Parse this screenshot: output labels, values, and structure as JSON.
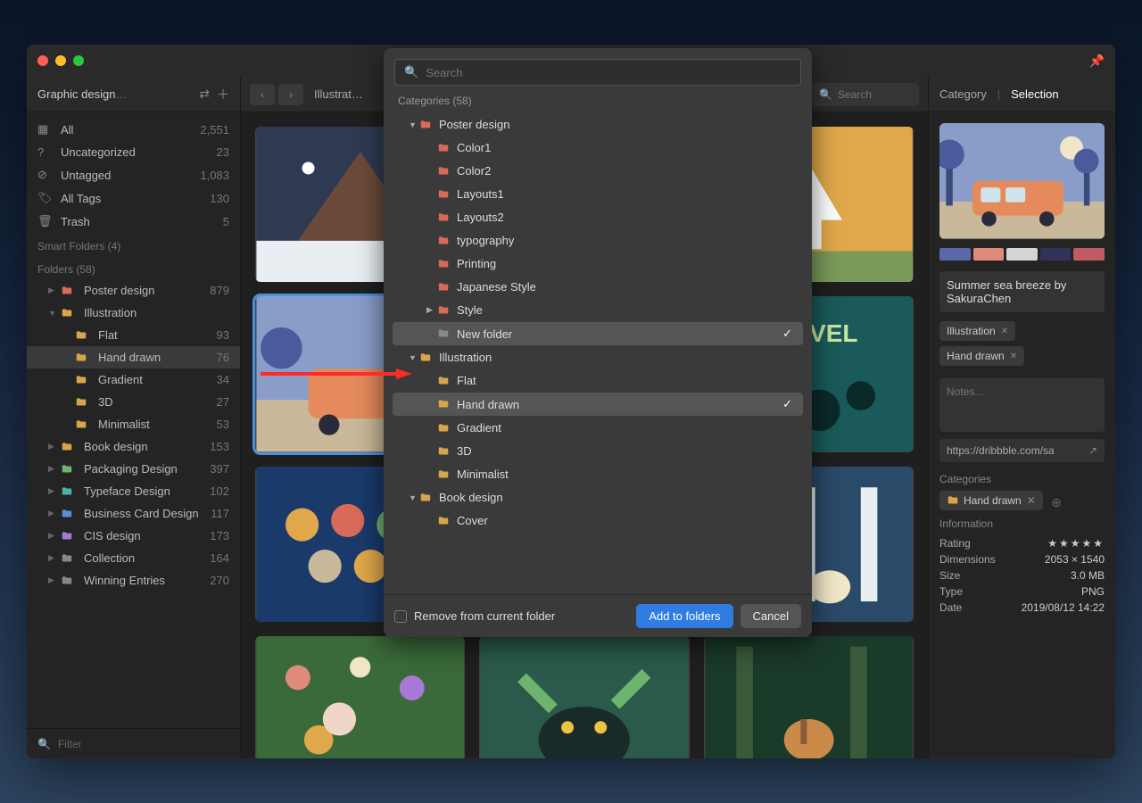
{
  "window": {
    "library_name": "Graphic design",
    "breadcrumb": "Illustrat…",
    "search_placeholder": "Search",
    "pin_glyph": "📌"
  },
  "tabs": {
    "category": "Category",
    "selection": "Selection"
  },
  "sidebar": {
    "system": [
      {
        "icon": "grid",
        "label": "All",
        "count": "2,551"
      },
      {
        "icon": "help",
        "label": "Uncategorized",
        "count": "23"
      },
      {
        "icon": "tagx",
        "label": "Untagged",
        "count": "1,083"
      },
      {
        "icon": "tags",
        "label": "All Tags",
        "count": "130"
      },
      {
        "icon": "trash",
        "label": "Trash",
        "count": "5"
      }
    ],
    "smart_header": "Smart Folders (4)",
    "folders_header": "Folders (58)",
    "folders": [
      {
        "label": "Poster design",
        "count": "879",
        "color": "red",
        "expanded": false
      },
      {
        "label": "Illustration",
        "count": "",
        "color": "orange",
        "expanded": true,
        "children": [
          {
            "label": "Flat",
            "count": "93"
          },
          {
            "label": "Hand drawn",
            "count": "76",
            "selected": true
          },
          {
            "label": "Gradient",
            "count": "34"
          },
          {
            "label": "3D",
            "count": "27"
          },
          {
            "label": "Minimalist",
            "count": "53"
          }
        ]
      },
      {
        "label": "Book design",
        "count": "153",
        "color": "orange"
      },
      {
        "label": "Packaging Design",
        "count": "397",
        "color": "green"
      },
      {
        "label": "Typeface Design",
        "count": "102",
        "color": "teal"
      },
      {
        "label": "Business Card Design",
        "count": "117",
        "color": "blue"
      },
      {
        "label": "CIS design",
        "count": "173",
        "color": "purple"
      },
      {
        "label": "Collection",
        "count": "164",
        "color": "gray"
      },
      {
        "label": "Winning Entries",
        "count": "270",
        "color": "gray"
      }
    ],
    "filter_placeholder": "Filter"
  },
  "modal": {
    "search_placeholder": "Search",
    "subhead": "Categories (58)",
    "tree": [
      {
        "label": "Poster design",
        "color": "red",
        "depth": 1,
        "expanded": true
      },
      {
        "label": "Color1",
        "color": "red",
        "depth": 2
      },
      {
        "label": "Color2",
        "color": "red",
        "depth": 2
      },
      {
        "label": "Layouts1",
        "color": "red",
        "depth": 2
      },
      {
        "label": "Layouts2",
        "color": "red",
        "depth": 2
      },
      {
        "label": "typography",
        "color": "red",
        "depth": 2
      },
      {
        "label": "Printing",
        "color": "red",
        "depth": 2
      },
      {
        "label": "Japanese Style",
        "color": "red",
        "depth": 2
      },
      {
        "label": "Style",
        "color": "red",
        "depth": 2,
        "hasChildren": true
      },
      {
        "label": "New folder",
        "color": "gray",
        "depth": 2,
        "selected": true,
        "checked": true
      },
      {
        "label": "Illustration",
        "color": "orange",
        "depth": 1,
        "expanded": true
      },
      {
        "label": "Flat",
        "color": "orange",
        "depth": 2
      },
      {
        "label": "Hand drawn",
        "color": "orange",
        "depth": 2,
        "selected": true,
        "checked": true
      },
      {
        "label": "Gradient",
        "color": "orange",
        "depth": 2
      },
      {
        "label": "3D",
        "color": "orange",
        "depth": 2
      },
      {
        "label": "Minimalist",
        "color": "orange",
        "depth": 2
      },
      {
        "label": "Book design",
        "color": "orange",
        "depth": 1,
        "expanded": true
      },
      {
        "label": "Cover",
        "color": "orange",
        "depth": 2
      }
    ],
    "remove_label": "Remove from current folder",
    "add_label": "Add to folders",
    "cancel_label": "Cancel"
  },
  "inspector": {
    "swatches": [
      "#5a67a8",
      "#e08a7b",
      "#d5d5d5",
      "#32315a",
      "#c15a63"
    ],
    "title": "Summer sea breeze by SakuraChen",
    "tags": [
      "Illustration",
      "Hand drawn"
    ],
    "notes_placeholder": "Notes...",
    "url": "https://dribbble.com/sa",
    "categories_label": "Categories",
    "category_chip": "Hand drawn",
    "info_label": "Information",
    "rating_label": "Rating",
    "rating_value": "★★★★★",
    "dimensions_label": "Dimensions",
    "dimensions_value": "2053 × 1540",
    "size_label": "Size",
    "size_value": "3.0 MB",
    "type_label": "Type",
    "type_value": "PNG",
    "date_label": "Date",
    "date_value": "2019/08/12 14:22"
  }
}
